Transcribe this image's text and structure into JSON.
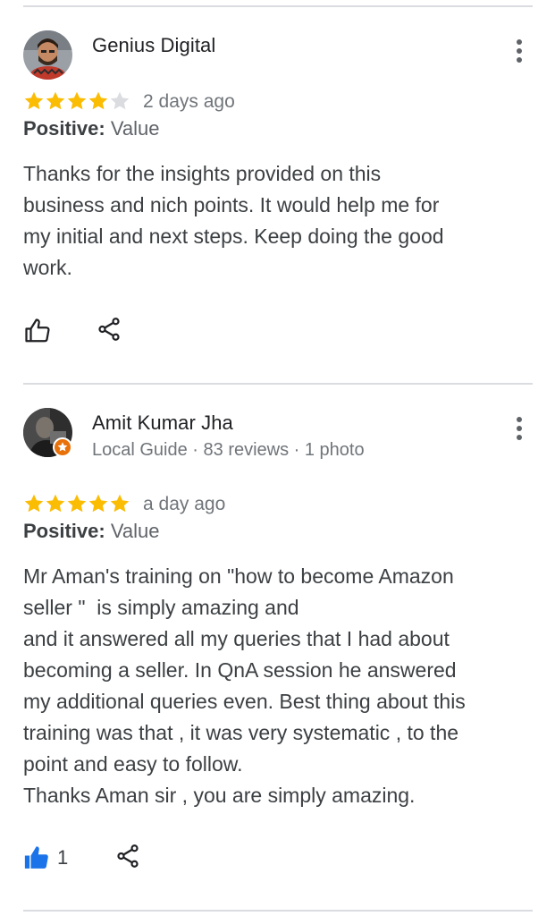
{
  "reviews": [
    {
      "author": "Genius Digital",
      "meta": "",
      "rating": 4,
      "max_rating": 5,
      "date": "2 days ago",
      "positive_label": "Positive:",
      "positive_value": "Value",
      "text": "Thanks for the insights provided on this\nbusiness and nich points. It would help me for\nmy initial and next steps. Keep doing the good\nwork.",
      "like_count": "",
      "liked": false
    },
    {
      "author": "Amit Kumar Jha",
      "meta": "Local Guide · 83 reviews · 1 photo",
      "rating": 5,
      "max_rating": 5,
      "date": "a day ago",
      "positive_label": "Positive:",
      "positive_value": "Value",
      "text": "Mr Aman's training on \"how to become Amazon\nseller \"  is simply amazing and\nand it answered all my queries that I had about\nbecoming a seller. In QnA session he answered\nmy additional queries even. Best thing about this\ntraining was that , it was very systematic , to the\npoint and easy to follow.\nThanks Aman sir , you are simply amazing.",
      "like_count": "1",
      "liked": true
    }
  ],
  "colors": {
    "star_filled": "#fbbc04",
    "star_empty": "#dadce0",
    "like_active": "#1a73e8",
    "local_guide_badge": "#e8710a"
  },
  "icons": [
    "thumbs-up-icon",
    "share-icon",
    "more-vert-icon",
    "star-icon",
    "local-guide-badge-icon"
  ]
}
